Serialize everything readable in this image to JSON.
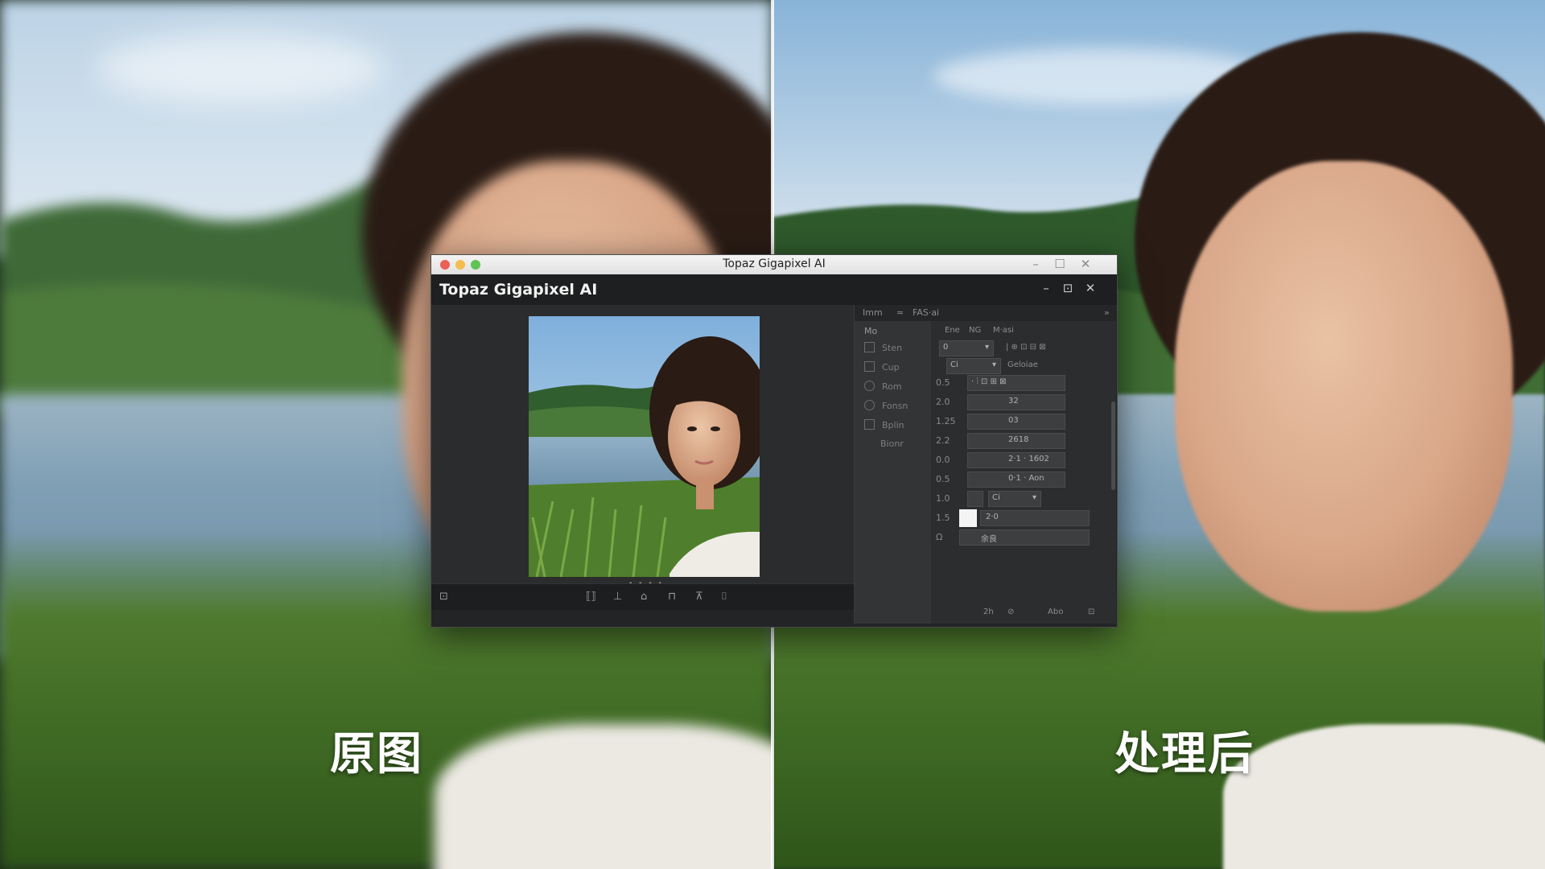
{
  "captions": {
    "left": "原图",
    "right": "处理后"
  },
  "window": {
    "title": "Topaz Gigapixel AI",
    "app_name": "Topaz Gigapixel AI",
    "controls": {
      "minimize": "–",
      "maximize": "☐",
      "close": "✕"
    },
    "app_controls": {
      "minimize": "–",
      "maximize": "⊡",
      "close": "✕"
    }
  },
  "preview": {
    "pager": "• • • •"
  },
  "bottom_toolbar": {
    "icons": [
      "⊡",
      "⟦⟧",
      "⊥",
      "⌂",
      "⊓",
      "⊼",
      "⌷"
    ]
  },
  "side_panel": {
    "tabs": [
      "Imm",
      "≈",
      "FAS·ai"
    ],
    "tab_more": "»",
    "column_header": "Mo",
    "items": [
      "Sten",
      "Cup",
      "Rom",
      "Fonsn",
      "Bplin",
      "Bionr"
    ],
    "top_row": [
      "Ene",
      "NG",
      "M·asi"
    ],
    "rows": [
      {
        "label": "0.5",
        "value": ""
      },
      {
        "label": "2.0",
        "value": "32"
      },
      {
        "label": "1.25",
        "value": "03"
      },
      {
        "label": "2.2",
        "value": "2618"
      },
      {
        "label": "0.0",
        "value": "2·1 · 1602"
      },
      {
        "label": "0.5",
        "value": "0·1 · Aon"
      },
      {
        "label": "1.0",
        "value": "Ci"
      },
      {
        "label": "1.5",
        "value": "2·0"
      },
      {
        "label": "Ω",
        "value": "余良"
      }
    ],
    "select1": "0",
    "select2": "Ci",
    "field_label": "Geloiae",
    "footer": [
      "2h",
      "⊘",
      "Abo",
      "⊡"
    ]
  }
}
